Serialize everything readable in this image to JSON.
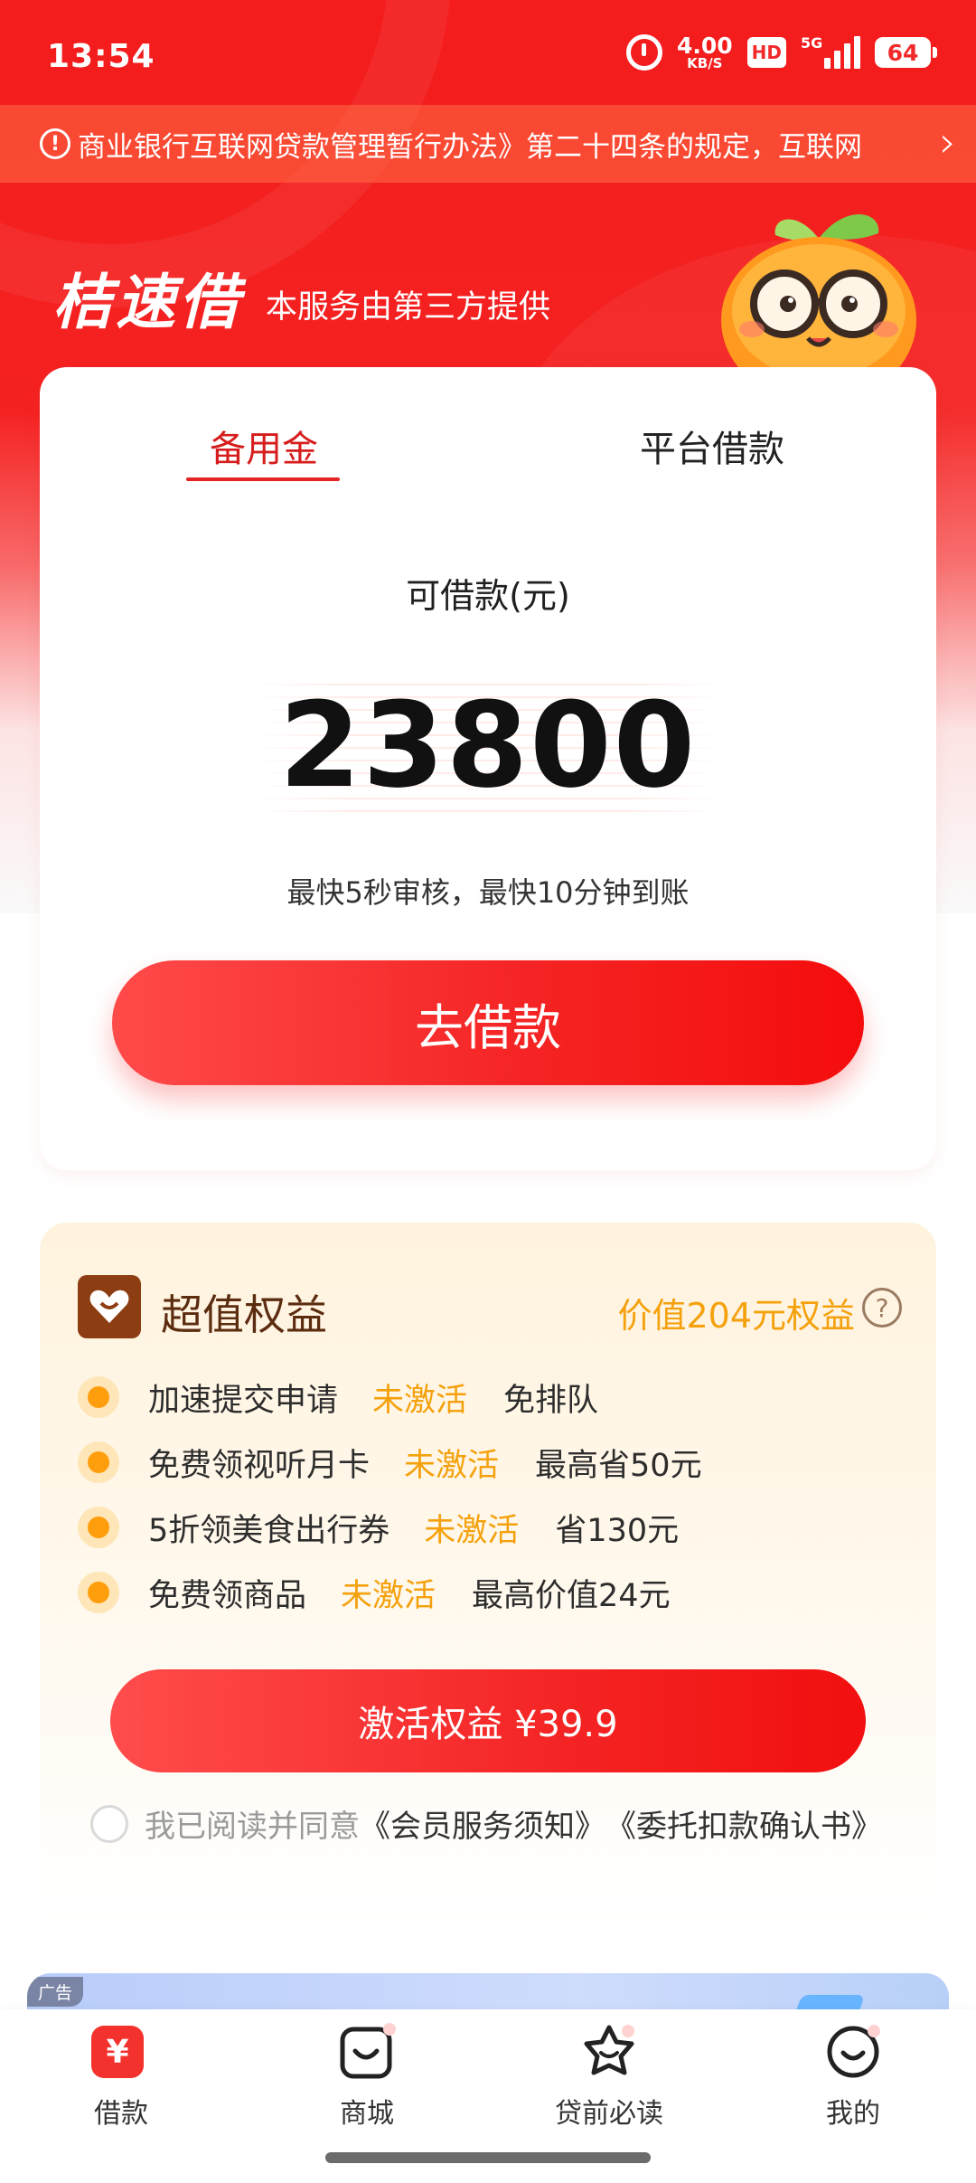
{
  "status_bar": {
    "time": "13:54",
    "net_speed_value": "4.00",
    "net_speed_unit": "KB/S",
    "hd_badge": "HD",
    "signal_label": "5G",
    "battery": "64",
    "icons": [
      "alarm-icon",
      "signal-icon",
      "battery-icon"
    ]
  },
  "notice": {
    "icon": "info-icon",
    "text": "商业银行互联网贷款管理暂行办法》第二十四条的规定，互联网",
    "arrow": "chevron-right-icon"
  },
  "brand": {
    "logo": "桔速借",
    "subtitle": "本服务由第三方提供",
    "mascot": "orange-mascot-icon"
  },
  "loan_card": {
    "tabs": [
      {
        "label": "备用金",
        "active": true
      },
      {
        "label": "平台借款",
        "active": false
      }
    ],
    "available_label": "可借款(元)",
    "amount": "23800",
    "speed_note": "最快5秒审核，最快10分钟到账",
    "button_label": "去借款"
  },
  "benefits": {
    "title": "超值权益",
    "value_label": "价值204元权益",
    "help_icon": "?",
    "items": [
      {
        "name": "加速提交申请",
        "status": "未激活",
        "perk": "免排队"
      },
      {
        "name": "免费领视听月卡",
        "status": "未激活",
        "perk": "最高省50元"
      },
      {
        "name": "5折领美食出行券",
        "status": "未激活",
        "perk": "省130元"
      },
      {
        "name": "免费领商品",
        "status": "未激活",
        "perk": "最高价值24元"
      }
    ],
    "button_label": "激活权益 ¥39.9",
    "agree_prefix": "我已阅读并同意",
    "agree_link_1": "《会员服务须知》",
    "agree_link_2": "《委托扣款确认书》"
  },
  "ad": {
    "tag": "广告"
  },
  "bottom_nav": [
    {
      "label": "借款",
      "icon": "yen-icon",
      "active": true
    },
    {
      "label": "商城",
      "icon": "shop-bag-icon",
      "active": false
    },
    {
      "label": "贷前必读",
      "icon": "star-face-icon",
      "active": false
    },
    {
      "label": "我的",
      "icon": "smile-face-icon",
      "active": false
    }
  ],
  "colors": {
    "brand_red": "#f41c1c",
    "button_red": "#f52424",
    "accent_orange": "#f5a10d",
    "benefit_brown": "#5b2c0f"
  }
}
